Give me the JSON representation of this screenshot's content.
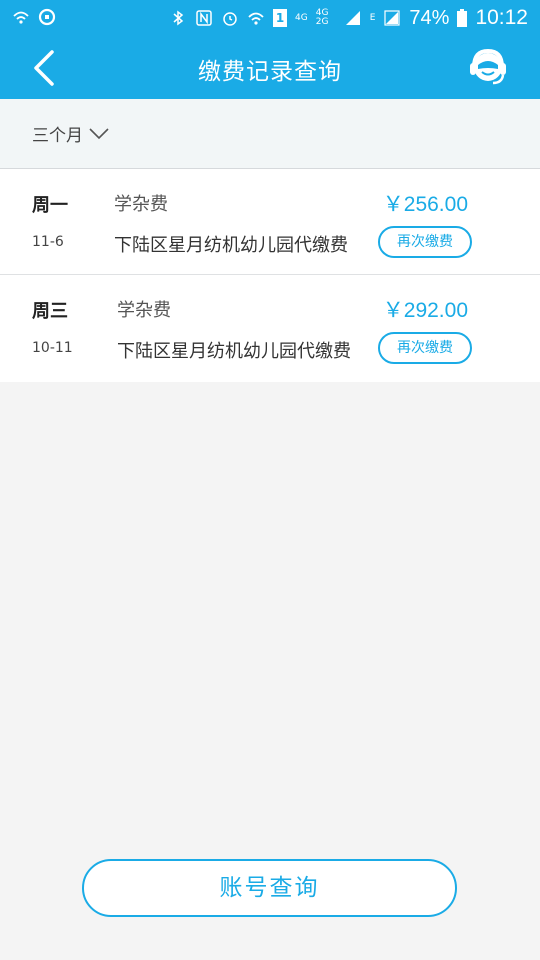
{
  "status_bar": {
    "network_4g": "4G",
    "network_4g2g": "4G 2G",
    "signal_e": "E",
    "sim_badge": "1",
    "battery": "74%",
    "time": "10:12"
  },
  "header": {
    "title": "缴费记录查询",
    "back_icon": "back-chevron-icon",
    "service_icon": "customer-service-icon"
  },
  "filter": {
    "label": "三个月"
  },
  "records": [
    {
      "weekday": "周一",
      "date": "11-6",
      "type": "学杂费",
      "description": "下陆区星月纺机幼儿园代缴费",
      "amount": "￥256.00",
      "action": "再次缴费"
    },
    {
      "weekday": "周三",
      "date": "10-11",
      "type": "学杂费",
      "description": "下陆区星月纺机幼儿园代缴费",
      "amount": "￥292.00",
      "action": "再次缴费"
    }
  ],
  "bottom": {
    "button_label": "账号查询"
  },
  "colors": {
    "accent": "#1aabe6",
    "background": "#f4f4f4",
    "filter_bar": "#f2f6f7"
  }
}
